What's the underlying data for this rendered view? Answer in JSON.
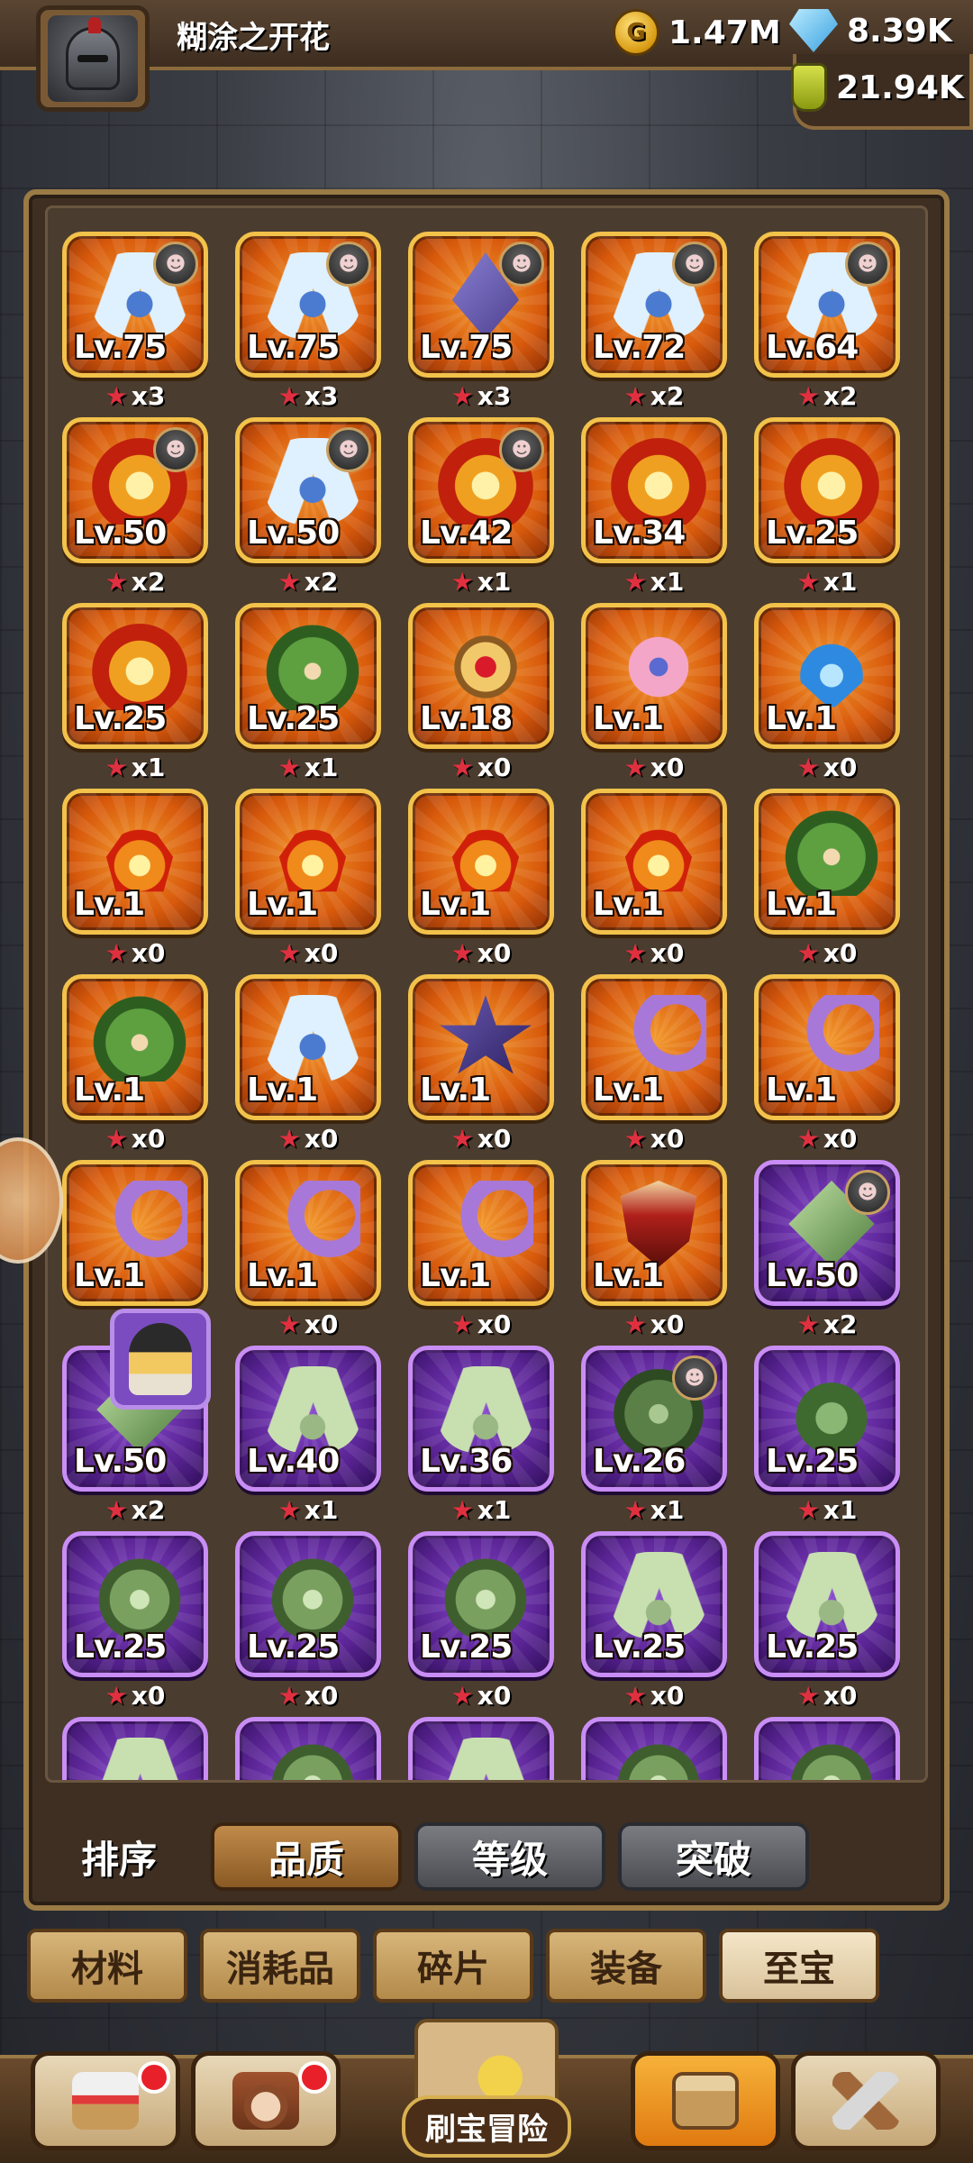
{
  "player": {
    "name": "糊涂之开花"
  },
  "currency": {
    "gold": "1.47M",
    "gems": "8.39K",
    "potion": "21.94K"
  },
  "items": [
    {
      "lv": "Lv.75",
      "stars": "x3",
      "rarity": "legend",
      "icon": "wings-icon",
      "badge": true
    },
    {
      "lv": "Lv.75",
      "stars": "x3",
      "rarity": "legend",
      "icon": "wings-icon",
      "badge": true
    },
    {
      "lv": "Lv.75",
      "stars": "x3",
      "rarity": "legend",
      "icon": "crystal-icon",
      "badge": true
    },
    {
      "lv": "Lv.72",
      "stars": "x2",
      "rarity": "legend",
      "icon": "wings-icon",
      "badge": true
    },
    {
      "lv": "Lv.64",
      "stars": "x2",
      "rarity": "legend",
      "icon": "wings-icon",
      "badge": true
    },
    {
      "lv": "Lv.50",
      "stars": "x2",
      "rarity": "legend",
      "icon": "demon-icon",
      "badge": true
    },
    {
      "lv": "Lv.50",
      "stars": "x2",
      "rarity": "legend",
      "icon": "wings-icon",
      "badge": true
    },
    {
      "lv": "Lv.42",
      "stars": "x1",
      "rarity": "legend",
      "icon": "demon-icon",
      "badge": true
    },
    {
      "lv": "Lv.34",
      "stars": "x1",
      "rarity": "legend",
      "icon": "demon-icon",
      "badge": false
    },
    {
      "lv": "Lv.25",
      "stars": "x1",
      "rarity": "legend",
      "icon": "demon-icon",
      "badge": false
    },
    {
      "lv": "Lv.25",
      "stars": "x1",
      "rarity": "legend",
      "icon": "demon-icon",
      "badge": false
    },
    {
      "lv": "Lv.25",
      "stars": "x1",
      "rarity": "legend",
      "icon": "beetle-icon",
      "badge": false
    },
    {
      "lv": "Lv.18",
      "stars": "x0",
      "rarity": "legend",
      "icon": "medallion-icon",
      "badge": false
    },
    {
      "lv": "Lv.1",
      "stars": "x0",
      "rarity": "legend",
      "icon": "flower-icon",
      "badge": false
    },
    {
      "lv": "Lv.1",
      "stars": "x0",
      "rarity": "legend",
      "icon": "drop-icon",
      "badge": false
    },
    {
      "lv": "Lv.1",
      "stars": "x0",
      "rarity": "legend",
      "icon": "flame-icon",
      "badge": false
    },
    {
      "lv": "Lv.1",
      "stars": "x0",
      "rarity": "legend",
      "icon": "flame-icon",
      "badge": false
    },
    {
      "lv": "Lv.1",
      "stars": "x0",
      "rarity": "legend",
      "icon": "flame-icon",
      "badge": false
    },
    {
      "lv": "Lv.1",
      "stars": "x0",
      "rarity": "legend",
      "icon": "flame-icon",
      "badge": false
    },
    {
      "lv": "Lv.1",
      "stars": "x0",
      "rarity": "legend",
      "icon": "beetle-icon",
      "badge": false
    },
    {
      "lv": "Lv.1",
      "stars": "x0",
      "rarity": "legend",
      "icon": "beetle-icon",
      "badge": false
    },
    {
      "lv": "Lv.1",
      "stars": "x0",
      "rarity": "legend",
      "icon": "wings-icon",
      "badge": false
    },
    {
      "lv": "Lv.1",
      "stars": "x0",
      "rarity": "legend",
      "icon": "star-icon",
      "badge": false
    },
    {
      "lv": "Lv.1",
      "stars": "x0",
      "rarity": "legend",
      "icon": "moon-icon",
      "badge": false
    },
    {
      "lv": "Lv.1",
      "stars": "x0",
      "rarity": "legend",
      "icon": "moon-icon",
      "badge": false
    },
    {
      "lv": "Lv.1",
      "stars": "",
      "rarity": "legend",
      "icon": "moon-icon",
      "badge": false
    },
    {
      "lv": "Lv.1",
      "stars": "x0",
      "rarity": "legend",
      "icon": "moon-icon",
      "badge": false
    },
    {
      "lv": "Lv.1",
      "stars": "x0",
      "rarity": "legend",
      "icon": "moon-icon",
      "badge": false
    },
    {
      "lv": "Lv.1",
      "stars": "x0",
      "rarity": "legend",
      "icon": "shield-icon",
      "badge": false
    },
    {
      "lv": "Lv.50",
      "stars": "x2",
      "rarity": "epic",
      "icon": "green-crystal-icon",
      "badge": true
    },
    {
      "lv": "Lv.50",
      "stars": "x2",
      "rarity": "epic",
      "icon": "green-crystal-icon",
      "badge": false
    },
    {
      "lv": "Lv.40",
      "stars": "x1",
      "rarity": "epic",
      "icon": "green-wings-icon",
      "badge": false
    },
    {
      "lv": "Lv.36",
      "stars": "x1",
      "rarity": "epic",
      "icon": "green-wings-icon",
      "badge": false
    },
    {
      "lv": "Lv.26",
      "stars": "x1",
      "rarity": "epic",
      "icon": "green-beetle-icon",
      "badge": true
    },
    {
      "lv": "Lv.25",
      "stars": "x1",
      "rarity": "epic",
      "icon": "green-leaf-icon",
      "badge": false
    },
    {
      "lv": "Lv.25",
      "stars": "x0",
      "rarity": "epic",
      "icon": "green-dragon-icon",
      "badge": false
    },
    {
      "lv": "Lv.25",
      "stars": "x0",
      "rarity": "epic",
      "icon": "green-dragon-icon",
      "badge": false
    },
    {
      "lv": "Lv.25",
      "stars": "x0",
      "rarity": "epic",
      "icon": "green-dragon-icon",
      "badge": false
    },
    {
      "lv": "Lv.25",
      "stars": "x0",
      "rarity": "epic",
      "icon": "green-wings-icon",
      "badge": false
    },
    {
      "lv": "Lv.25",
      "stars": "x0",
      "rarity": "epic",
      "icon": "green-wings-icon",
      "badge": false
    },
    {
      "lv": "",
      "stars": "",
      "rarity": "epic",
      "icon": "green-wings-icon",
      "badge": false
    },
    {
      "lv": "",
      "stars": "",
      "rarity": "epic",
      "icon": "green-dragon-icon",
      "badge": false
    },
    {
      "lv": "",
      "stars": "",
      "rarity": "epic",
      "icon": "green-wings-icon",
      "badge": false
    },
    {
      "lv": "",
      "stars": "",
      "rarity": "epic",
      "icon": "green-dragon-icon",
      "badge": false
    },
    {
      "lv": "",
      "stars": "",
      "rarity": "epic",
      "icon": "green-dragon-icon",
      "badge": false
    }
  ],
  "sort": {
    "label": "排序",
    "options": [
      "品质",
      "等级",
      "突破"
    ],
    "active": 0
  },
  "categories": {
    "tabs": [
      "材料",
      "消耗品",
      "碎片",
      "装备",
      "至宝"
    ],
    "active": 4
  },
  "nav": {
    "adventure_label": "刷宝冒险",
    "buttons": [
      "shop-icon",
      "hero-icon",
      "adventure-map-icon",
      "bag-icon",
      "forge-icon"
    ]
  },
  "colors": {
    "legend_border": "#f2c24a",
    "epic_border": "#c98ef5",
    "star": "#e03040",
    "notification": "#e8202a"
  }
}
